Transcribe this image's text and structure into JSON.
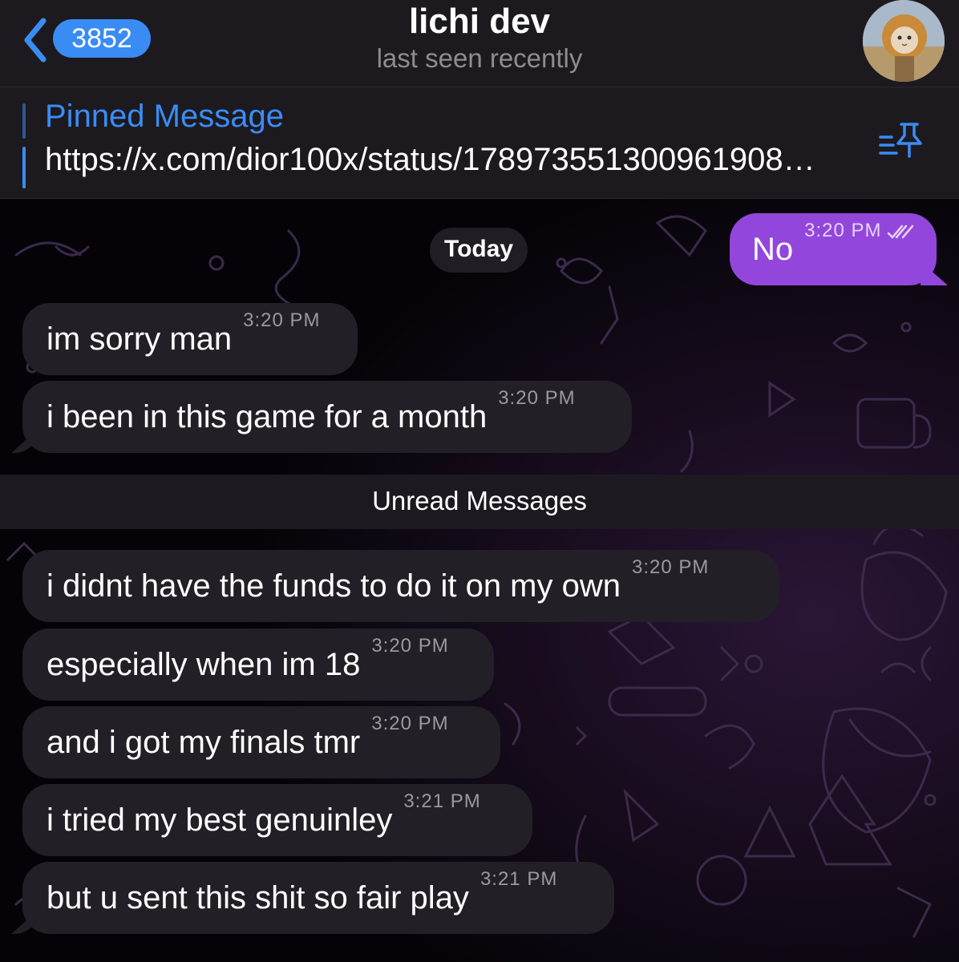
{
  "header": {
    "unread_count": "3852",
    "title": "lichi dev",
    "status": "last seen recently",
    "avatar_icon": "lion-mane-cat-avatar"
  },
  "pinned": {
    "title": "Pinned Message",
    "text": "https://x.com/dior100x/status/178973551300961908…",
    "list_icon": "pinned-list-icon"
  },
  "chat": {
    "date_label": "Today",
    "unread_label": "Unread Messages",
    "outgoing": [
      {
        "text": "No",
        "time": "3:20 PM",
        "status": "read"
      }
    ],
    "before_unread": [
      {
        "text": "im sorry man",
        "time": "3:20 PM"
      },
      {
        "text": "i been in this game for a month",
        "time": "3:20 PM"
      }
    ],
    "after_unread": [
      {
        "text": "i didnt have the funds to do it on my own",
        "time": "3:20 PM"
      },
      {
        "text": "especially when im 18",
        "time": "3:20 PM"
      },
      {
        "text": "and i got my finals tmr",
        "time": "3:20 PM"
      },
      {
        "text": "i tried my best genuinley",
        "time": "3:21 PM"
      },
      {
        "text": "but u sent this shit so fair play",
        "time": "3:21 PM"
      }
    ]
  },
  "colors": {
    "accent": "#3a8cf5",
    "outgoing_bubble": "#9346db",
    "incoming_bubble": "#221f27"
  }
}
